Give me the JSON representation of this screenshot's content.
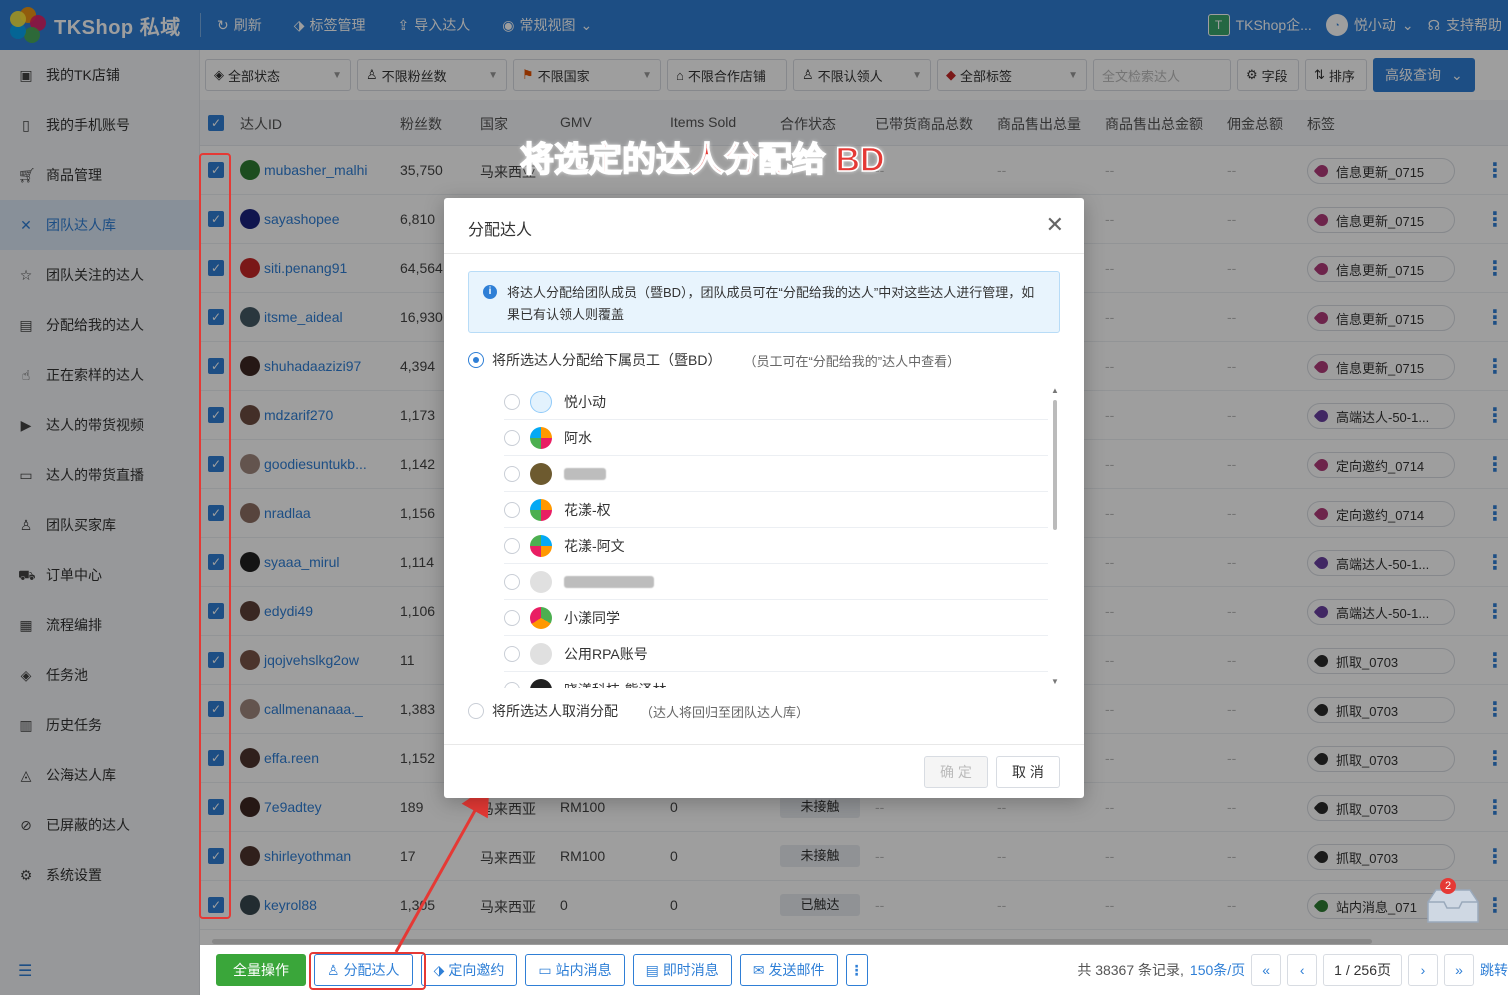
{
  "topbar": {
    "app_name": "TKShop 私域",
    "refresh": "刷新",
    "tag_manage": "标签管理",
    "import": "导入达人",
    "view": "常规视图",
    "enterprise_badge": "T",
    "enterprise": "TKShop企...",
    "user": "悦小动",
    "support": "支持帮助"
  },
  "sidebar": {
    "items": [
      {
        "label": "我的TK店铺",
        "icon": "store-icon"
      },
      {
        "label": "我的手机账号",
        "icon": "phone-icon"
      },
      {
        "label": "商品管理",
        "icon": "cart-icon"
      },
      {
        "label": "团队达人库",
        "icon": "team-icon",
        "active": true
      },
      {
        "label": "团队关注的达人",
        "icon": "star-icon"
      },
      {
        "label": "分配给我的达人",
        "icon": "assign-icon"
      },
      {
        "label": "正在索样的达人",
        "icon": "hand-icon"
      },
      {
        "label": "达人的带货视频",
        "icon": "video-icon"
      },
      {
        "label": "达人的带货直播",
        "icon": "live-icon"
      },
      {
        "label": "团队买家库",
        "icon": "buyer-icon"
      },
      {
        "label": "订单中心",
        "icon": "truck-icon"
      },
      {
        "label": "流程编排",
        "icon": "calendar-icon"
      },
      {
        "label": "任务池",
        "icon": "layers-icon"
      },
      {
        "label": "历史任务",
        "icon": "clipboard-icon"
      },
      {
        "label": "公海达人库",
        "icon": "image-icon"
      },
      {
        "label": "已屏蔽的达人",
        "icon": "block-icon"
      },
      {
        "label": "系统设置",
        "icon": "gear-icon"
      }
    ]
  },
  "filters": {
    "status": "全部状态",
    "fans": "不限粉丝数",
    "country": "不限国家",
    "coop_store": "不限合作店铺",
    "claimer": "不限认领人",
    "tags": "全部标签",
    "search_placeholder": "全文检索达人",
    "fields": "字段",
    "sort": "排序",
    "advanced": "高级查询"
  },
  "table": {
    "headers": [
      "达人ID",
      "粉丝数",
      "国家",
      "GMV",
      "Items Sold",
      "合作状态",
      "已带货商品总数",
      "商品售出总量",
      "商品售出总金额",
      "佣金总额",
      "标签"
    ],
    "rows": [
      {
        "id": "mubasher_malhi",
        "fans": "35,750",
        "country": "马来西亚",
        "gmv": "",
        "sold": "",
        "status": "",
        "tag": "信息更新_0715",
        "tag_color": "#b03a7a",
        "av": "#2e7d32"
      },
      {
        "id": "sayashopee",
        "fans": "6,810",
        "country": "",
        "gmv": "",
        "sold": "",
        "status": "",
        "tag": "信息更新_0715",
        "tag_color": "#b03a7a",
        "av": "#1a237e"
      },
      {
        "id": "siti.penang91",
        "fans": "64,564",
        "country": "",
        "gmv": "",
        "sold": "",
        "status": "",
        "tag": "信息更新_0715",
        "tag_color": "#b03a7a",
        "av": "#c62828"
      },
      {
        "id": "itsme_aideal",
        "fans": "16,930",
        "country": "",
        "gmv": "",
        "sold": "",
        "status": "",
        "tag": "信息更新_0715",
        "tag_color": "#b03a7a",
        "av": "#455a64"
      },
      {
        "id": "shuhadaazizi97",
        "fans": "4,394",
        "country": "",
        "gmv": "",
        "sold": "",
        "status": "",
        "tag": "信息更新_0715",
        "tag_color": "#b03a7a",
        "av": "#3e2723"
      },
      {
        "id": "mdzarif270",
        "fans": "1,173",
        "country": "",
        "gmv": "",
        "sold": "",
        "status": "",
        "tag": "高端达人-50-1...",
        "tag_color": "#6a3fa0",
        "av": "#6d4c41"
      },
      {
        "id": "goodiesuntukb...",
        "fans": "1,142",
        "country": "",
        "gmv": "",
        "sold": "",
        "status": "",
        "tag": "定向邀约_0714",
        "tag_color": "#b03a7a",
        "av": "#a1887f"
      },
      {
        "id": "nradlaa",
        "fans": "1,156",
        "country": "",
        "gmv": "",
        "sold": "",
        "status": "",
        "tag": "定向邀约_0714",
        "tag_color": "#b03a7a",
        "av": "#8d6e63"
      },
      {
        "id": "syaaa_mirul",
        "fans": "1,114",
        "country": "",
        "gmv": "",
        "sold": "",
        "status": "",
        "tag": "高端达人-50-1...",
        "tag_color": "#6a3fa0",
        "av": "#212121"
      },
      {
        "id": "edydi49",
        "fans": "1,106",
        "country": "",
        "gmv": "",
        "sold": "",
        "status": "",
        "tag": "高端达人-50-1...",
        "tag_color": "#6a3fa0",
        "av": "#5d4037"
      },
      {
        "id": "jqojvehslkg2ow",
        "fans": "11",
        "country": "",
        "gmv": "",
        "sold": "",
        "status": "",
        "tag": "抓取_0703",
        "tag_color": "#2b2b2b",
        "av": "#795548"
      },
      {
        "id": "callmenanaaa._",
        "fans": "1,383",
        "country": "",
        "gmv": "",
        "sold": "",
        "status": "",
        "tag": "抓取_0703",
        "tag_color": "#2b2b2b",
        "av": "#a1887f"
      },
      {
        "id": "effa.reen",
        "fans": "1,152",
        "country": "",
        "gmv": "",
        "sold": "",
        "status": "",
        "tag": "抓取_0703",
        "tag_color": "#2b2b2b",
        "av": "#4e342e"
      },
      {
        "id": "7e9adtey",
        "fans": "189",
        "country": "马来西亚",
        "gmv": "RM100",
        "sold": "0",
        "status": "未接触",
        "tag": "抓取_0703",
        "tag_color": "#2b2b2b",
        "av": "#3e2723"
      },
      {
        "id": "shirleyothman",
        "fans": "17",
        "country": "马来西亚",
        "gmv": "RM100",
        "sold": "0",
        "status": "未接触",
        "tag": "抓取_0703",
        "tag_color": "#2b2b2b",
        "av": "#4e342e"
      },
      {
        "id": "keyrol88",
        "fans": "1,305",
        "country": "马来西亚",
        "gmv": "0",
        "sold": "0",
        "status": "已触达",
        "tag": "站内消息_071",
        "tag_color": "#2e7d32",
        "av": "#37474f"
      }
    ],
    "dash": "--"
  },
  "bottom": {
    "all_ops": "全量操作",
    "assign": "分配达人",
    "invite": "定向邀约",
    "site_msg": "站内消息",
    "instant_msg": "即时消息",
    "email": "发送邮件",
    "more": "⋮",
    "total": "共 38367 条记录,",
    "page_size": "150条/页",
    "page": "1 / 256页",
    "jump": "跳转"
  },
  "annotation": "将选定的达人分配给 BD",
  "modal": {
    "title": "分配达人",
    "info": "将达人分配给团队成员（暨BD），团队成员可在“分配给我的达人”中对这些达人进行管理，如果已有认领人则覆盖",
    "option1": "将所选达人分配给下属员工（暨BD）",
    "option1_note": "（员工可在“分配给我的”达人中查看）",
    "employees": [
      {
        "name": "悦小动",
        "av": "logo"
      },
      {
        "name": "阿水",
        "av": "flower"
      },
      {
        "name": "",
        "av": "photo",
        "blur_w": 42
      },
      {
        "name": "花漾-权",
        "av": "flower"
      },
      {
        "name": "花漾-阿文",
        "av": "flower2"
      },
      {
        "name": "",
        "av": "gray",
        "blur_w": 90
      },
      {
        "name": "小漾同学",
        "av": "flower3"
      },
      {
        "name": "公用RPA账号",
        "av": "gray"
      },
      {
        "name": "晓漾科技-熊泽林",
        "av": "dark"
      }
    ],
    "option2": "将所选达人取消分配",
    "option2_note": "（达人将回归至团队达人库）",
    "ok": "确 定",
    "cancel": "取 消"
  },
  "msg_badge": "2"
}
